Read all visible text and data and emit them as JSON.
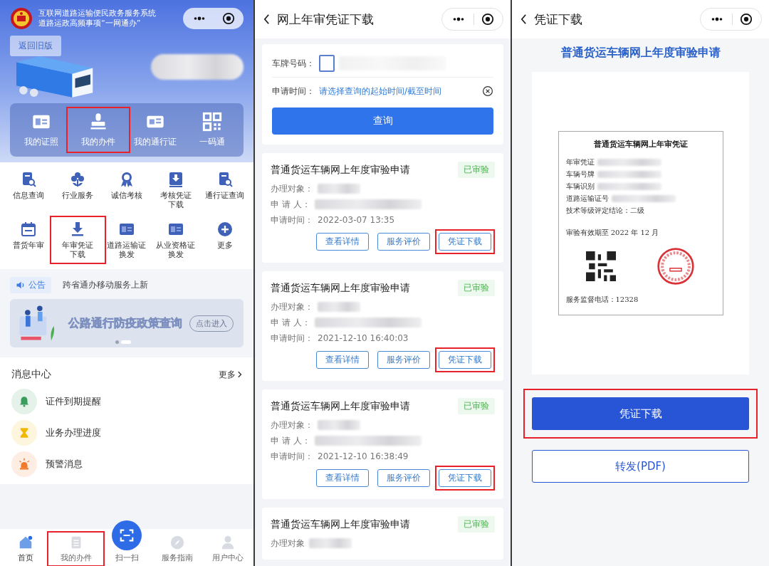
{
  "left_screen": {
    "header": {
      "title_lines": [
        "互联网道路运输便民政务服务系统",
        "道路运政高频事项“一网通办”"
      ],
      "back_button": "返回旧版"
    },
    "quick_links": [
      {
        "label": "我的证照",
        "highlighted": false
      },
      {
        "label": "我的办件",
        "highlighted": true
      },
      {
        "label": "我的通行证",
        "highlighted": false
      },
      {
        "label": "一码通",
        "highlighted": false
      }
    ],
    "services": [
      {
        "label": "信息查询",
        "highlighted": false
      },
      {
        "label": "行业服务",
        "highlighted": false
      },
      {
        "label": "诚信考核",
        "highlighted": false
      },
      {
        "lines": [
          "考核凭证",
          "下载"
        ],
        "highlighted": false
      },
      {
        "label": "通行证查询",
        "highlighted": false
      },
      {
        "label": "普货年审",
        "highlighted": false
      },
      {
        "lines": [
          "年审凭证",
          "下载"
        ],
        "highlighted": true
      },
      {
        "lines": [
          "道路运输证",
          "换发"
        ],
        "highlighted": false
      },
      {
        "lines": [
          "从业资格证",
          "换发"
        ],
        "highlighted": false
      },
      {
        "label": "更多",
        "highlighted": false
      }
    ],
    "notice": {
      "tag": "公告",
      "text": "跨省通办移动服务上新"
    },
    "banner": {
      "text": "公路通行防疫政策查询",
      "button": "点击进入"
    },
    "messages": {
      "title": "消息中心",
      "more": "更多",
      "items": [
        {
          "label": "证件到期提醒",
          "color": "#3a9d5d"
        },
        {
          "label": "业务办理进度",
          "color": "#f2b705"
        },
        {
          "label": "预警消息",
          "color": "#f07a2a"
        }
      ]
    },
    "tabbar": [
      {
        "kind": "tab",
        "label": "首页",
        "selected": true,
        "highlighted": false
      },
      {
        "kind": "tab",
        "label": "我的办件",
        "selected": false,
        "highlighted": true
      },
      {
        "kind": "scan",
        "label": "扫一扫",
        "selected": false,
        "highlighted": false
      },
      {
        "kind": "tab",
        "label": "服务指南",
        "selected": false,
        "highlighted": false
      },
      {
        "kind": "tab",
        "label": "用户中心",
        "selected": false,
        "highlighted": false
      }
    ]
  },
  "middle_screen": {
    "title": "网上年审凭证下载",
    "search": {
      "plate_label": "车牌号码：",
      "time_label": "申请时间：",
      "time_placeholder": "请选择查询的起始时间/截至时间",
      "query_button": "查询"
    },
    "records": [
      {
        "title": "普通货运车辆网上年度审验申请",
        "status": "已审验",
        "subject_label": "办理对象：",
        "applicant_label": "申 请 人：",
        "time_label": "申请时间：",
        "time": "2022-03-07 13:35",
        "buttons": [
          {
            "label": "查看详情",
            "highlighted": false
          },
          {
            "label": "服务评价",
            "highlighted": false
          },
          {
            "label": "凭证下载",
            "highlighted": true
          }
        ]
      },
      {
        "title": "普通货运车辆网上年度审验申请",
        "status": "已审验",
        "subject_label": "办理对象：",
        "applicant_label": "申 请 人：",
        "time_label": "申请时间：",
        "time": "2021-12-10 16:40:03",
        "buttons": [
          {
            "label": "查看详情",
            "highlighted": false
          },
          {
            "label": "服务评价",
            "highlighted": false
          },
          {
            "label": "凭证下载",
            "highlighted": true
          }
        ]
      },
      {
        "title": "普通货运车辆网上年度审验申请",
        "status": "已审验",
        "subject_label": "办理对象：",
        "applicant_label": "申 请 人：",
        "time_label": "申请时间：",
        "time": "2021-12-10 16:38:49",
        "buttons": [
          {
            "label": "查看详情",
            "highlighted": false
          },
          {
            "label": "服务评价",
            "highlighted": false
          },
          {
            "label": "凭证下载",
            "highlighted": true
          }
        ]
      },
      {
        "title": "普通货运车辆网上年度审验申请",
        "status": "已审验",
        "subject_label": "办理对象"
      }
    ]
  },
  "right_screen": {
    "title": "凭证下载",
    "heading": "普通货运车辆网上年度审验申请",
    "certificate": {
      "title": "普通货运车辆网上年审凭证",
      "fields": [
        "年审凭证",
        "车辆号牌",
        "车辆识别",
        "道路运输证号"
      ],
      "rating": "技术等级评定结论：二级",
      "validity": "审验有效期至 2022 年 12 月",
      "hotline": "服务监督电话：12328"
    },
    "download_button": {
      "label": "凭证下载",
      "highlighted": true
    },
    "forward_button": "转发(PDF)"
  }
}
